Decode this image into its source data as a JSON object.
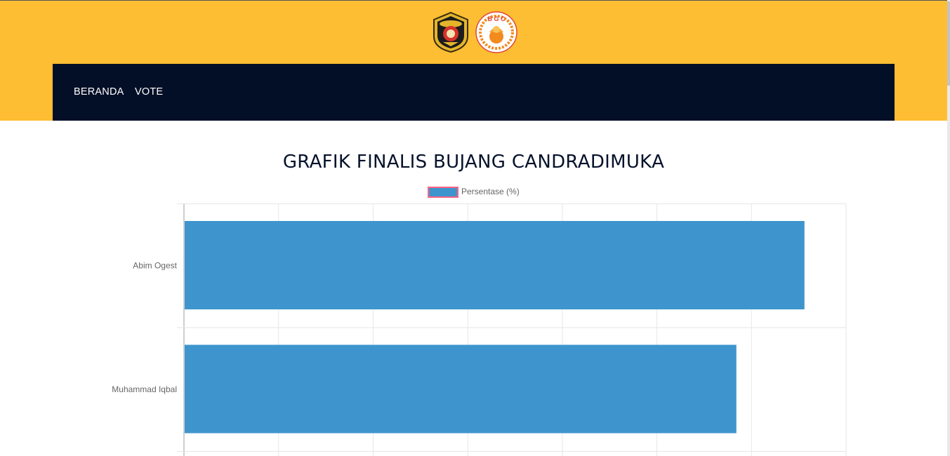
{
  "colors": {
    "header_bg": "#fdbe33",
    "nav_bg": "#030f27",
    "bar_fill": "#3e95cd",
    "legend_border": "#ff6384"
  },
  "logos": [
    {
      "name": "university-seal-logo"
    },
    {
      "name": "bgc-logo",
      "text": "B G C"
    }
  ],
  "nav": {
    "items": [
      {
        "label": "BERANDA"
      },
      {
        "label": "VOTE"
      }
    ]
  },
  "page": {
    "title": "GRAFIK FINALIS BUJANG CANDRADIMUKA"
  },
  "chart_data": {
    "type": "bar",
    "orientation": "horizontal",
    "categories": [
      "Abim Ogest",
      "Muhammad Iqbal"
    ],
    "series": [
      {
        "name": "Persentase (%)",
        "values": [
          65.6,
          58.4
        ]
      }
    ],
    "xlim": [
      0,
      70
    ],
    "grid": true,
    "legend": "top-center"
  }
}
